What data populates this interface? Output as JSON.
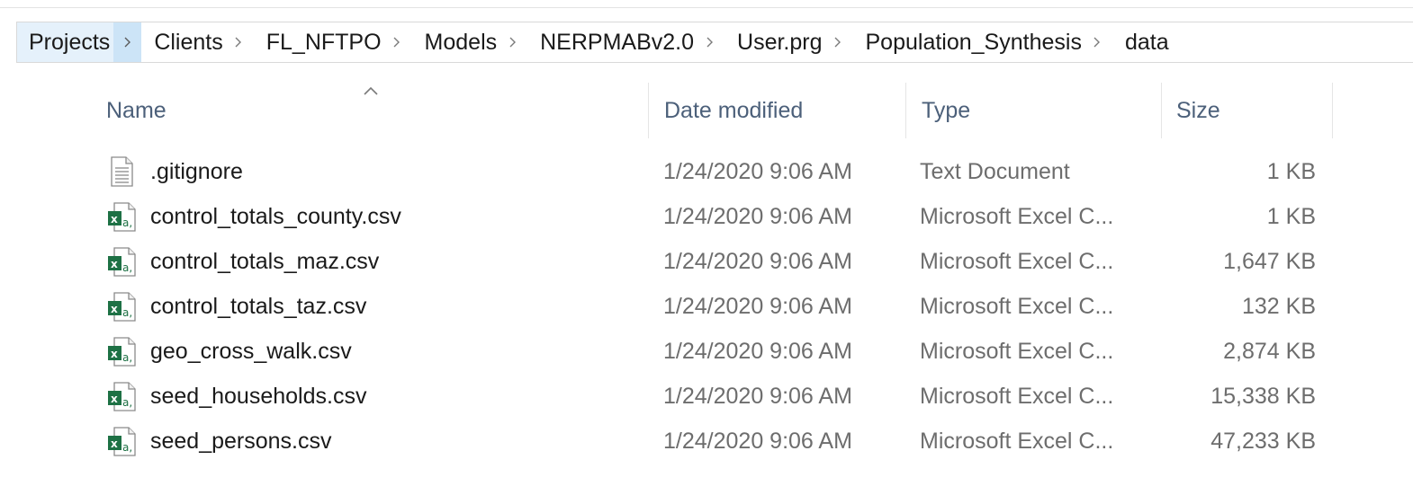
{
  "breadcrumb": [
    "Projects",
    "Clients",
    "FL_NFTPO",
    "Models",
    "NERPMABv2.0",
    "User.prg",
    "Population_Synthesis",
    "data"
  ],
  "columns": {
    "name": "Name",
    "date": "Date modified",
    "type": "Type",
    "size": "Size"
  },
  "files": [
    {
      "name": ".gitignore",
      "date": "1/24/2020 9:06 AM",
      "type": "Text Document",
      "size": "1 KB",
      "icon": "text-document-icon"
    },
    {
      "name": "control_totals_county.csv",
      "date": "1/24/2020 9:06 AM",
      "type": "Microsoft Excel C...",
      "size": "1 KB",
      "icon": "excel-csv-icon"
    },
    {
      "name": "control_totals_maz.csv",
      "date": "1/24/2020 9:06 AM",
      "type": "Microsoft Excel C...",
      "size": "1,647 KB",
      "icon": "excel-csv-icon"
    },
    {
      "name": "control_totals_taz.csv",
      "date": "1/24/2020 9:06 AM",
      "type": "Microsoft Excel C...",
      "size": "132 KB",
      "icon": "excel-csv-icon"
    },
    {
      "name": "geo_cross_walk.csv",
      "date": "1/24/2020 9:06 AM",
      "type": "Microsoft Excel C...",
      "size": "2,874 KB",
      "icon": "excel-csv-icon"
    },
    {
      "name": "seed_households.csv",
      "date": "1/24/2020 9:06 AM",
      "type": "Microsoft Excel C...",
      "size": "15,338 KB",
      "icon": "excel-csv-icon"
    },
    {
      "name": "seed_persons.csv",
      "date": "1/24/2020 9:06 AM",
      "type": "Microsoft Excel C...",
      "size": "47,233 KB",
      "icon": "excel-csv-icon"
    }
  ],
  "sort": {
    "column": "name",
    "direction": "ascending"
  },
  "colors": {
    "breadcrumb_highlight": "#e5f1fb",
    "header_text": "#4c607a",
    "excel_green": "#1e7145"
  }
}
